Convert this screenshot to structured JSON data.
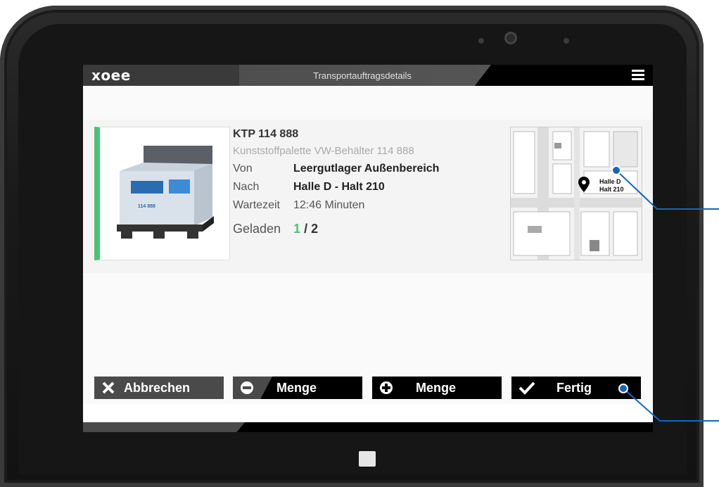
{
  "app": {
    "logo": "xoee",
    "title": "Transportauftragsdetails"
  },
  "item": {
    "title": "KTP 114 888",
    "subtitle": "Kunststoffpalette VW-Behälter 114 888",
    "rows": [
      {
        "key": "Von",
        "value": "Leergutlager Außenbereich"
      },
      {
        "key": "Nach",
        "value": "Halle D - Halt 210"
      },
      {
        "key": "Wartezeit",
        "value": "12:46 Minuten"
      }
    ],
    "loaded_label": "Geladen",
    "loaded_current": "1",
    "loaded_total": "/ 2",
    "accent_color": "#4bc27a",
    "container_number": "114 888"
  },
  "map": {
    "label_line1": "Halle D",
    "label_line2": "Halt 210"
  },
  "buttons": {
    "cancel": "Abbrechen",
    "minus": "Menge",
    "plus": "Menge",
    "done": "Fertig"
  },
  "icons": {
    "menu": "hamburger-menu-icon",
    "cancel": "close-icon",
    "minus": "minus-circle-icon",
    "plus": "plus-circle-icon",
    "done": "checkmark-icon",
    "pin": "location-pin-icon"
  },
  "callout_color": "#1565c0"
}
